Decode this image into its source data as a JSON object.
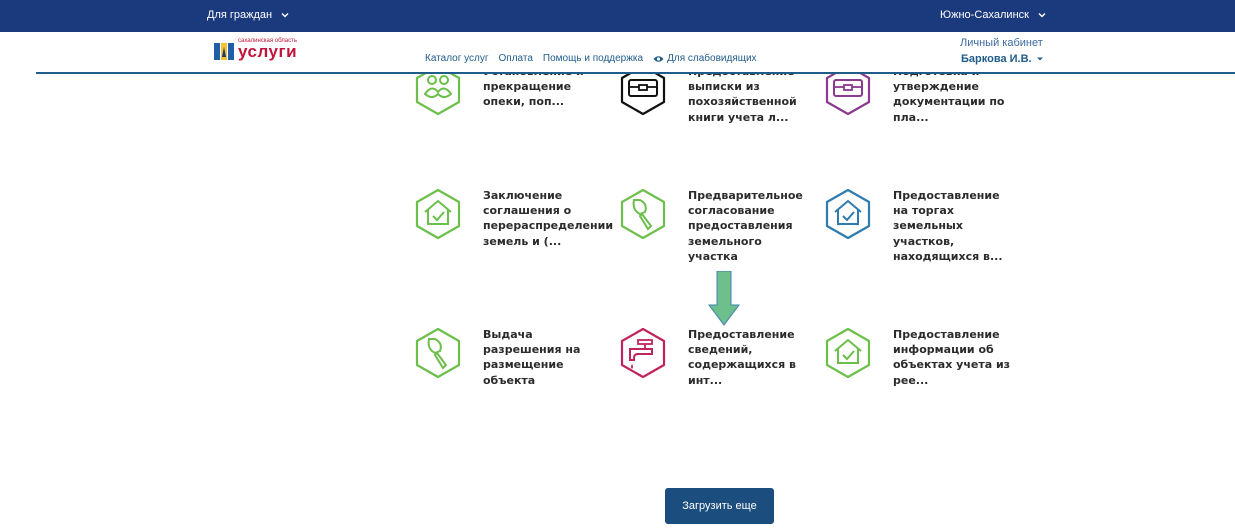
{
  "topbar": {
    "audience_label": "Для граждан",
    "city_label": "Южно-Сахалинск"
  },
  "header": {
    "logo_small": "сахалинская область",
    "logo_text": "услуги",
    "nav": {
      "catalog": "Каталог услуг",
      "payment": "Оплата",
      "help": "Помощь и поддержка",
      "accessibility": "Для слабовидящих"
    },
    "cabinet_label": "Личный кабинет",
    "user_name": "Баркова И.В."
  },
  "services": [
    {
      "title": "Установление и прекращение опеки, поп...",
      "icon": "people-icon",
      "color": "#6cbf4a"
    },
    {
      "title": "Предоставление выписки из похозяйственной книги учета л...",
      "icon": "briefcase-icon",
      "color": "#111111"
    },
    {
      "title": "Подготовка и утверждение документации по пла...",
      "icon": "briefcase-icon",
      "color": "#8b3a8f"
    },
    {
      "title": "Заключение соглашения о перераспределении земель и (...",
      "icon": "house-check-icon",
      "color": "#6cbf4a"
    },
    {
      "title": "Предварительное согласование предоставления земельного участка",
      "icon": "trowel-icon",
      "color": "#6cbf4a"
    },
    {
      "title": "Предоставление на торгах земельных участков, находящихся в...",
      "icon": "house-check-icon",
      "color": "#2e7bb0"
    },
    {
      "title": "Выдача разрешения на размещение объекта",
      "icon": "trowel-icon",
      "color": "#6cbf4a"
    },
    {
      "title": "Предоставление сведений, содержащихся в инт...",
      "icon": "faucet-icon",
      "color": "#c0245c"
    },
    {
      "title": "Предоставление информации об объектах учета из рее...",
      "icon": "house-check-icon",
      "color": "#6cbf4a"
    }
  ],
  "load_more_label": "Загрузить еще"
}
